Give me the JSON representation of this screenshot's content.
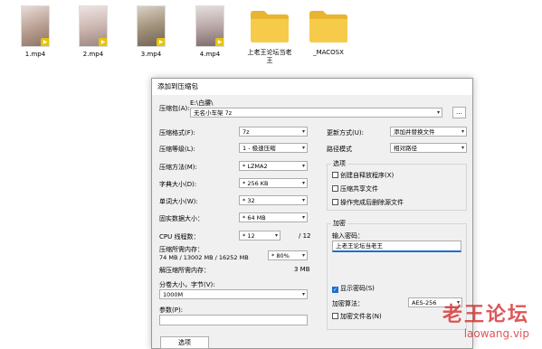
{
  "files": [
    {
      "name": "1.mp4",
      "type": "video",
      "thumb": "#c9b3a8"
    },
    {
      "name": "2.mp4",
      "type": "video",
      "thumb": "#d8c7c2"
    },
    {
      "name": "3.mp4",
      "type": "video",
      "thumb": "#a99a86"
    },
    {
      "name": "4.mp4",
      "type": "video",
      "thumb": "#c2b5b5"
    },
    {
      "name": "上老王论坛当老王",
      "type": "folder"
    },
    {
      "name": "_MACOSX",
      "type": "folder"
    }
  ],
  "dialog": {
    "title": "添加到压缩包",
    "archive_label": "压缩包(A):",
    "archive_path": "E:\\白腰\\",
    "archive_name": "无名小车架 7z",
    "browse_label": "...",
    "format_label": "压缩格式(F):",
    "format_value": "7z",
    "level_label": "压缩等级(L):",
    "level_value": "1 - 极速压缩",
    "method_label": "压缩方法(M):",
    "method_value": "* LZMA2",
    "dict_label": "字典大小(D):",
    "dict_value": "* 256 KB",
    "word_label": "单词大小(W):",
    "word_value": "* 32",
    "solid_label": "固实数据大小：",
    "solid_value": "* 64 MB",
    "cpu_label": "CPU 线程数：",
    "cpu_value": "* 12",
    "cpu_total": "/ 12",
    "mem_comp_label": "压缩所需内存：",
    "mem_comp_value": "74 MB / 13002 MB / 16252 MB",
    "mem_percent": "* 80%",
    "mem_decomp_label": "解压缩所需内存：",
    "mem_decomp_value": "3 MB",
    "split_label": "分卷大小，字节(V):",
    "split_value": "1000M",
    "params_label": "参数(P):",
    "params_value": "",
    "ok_label": "选项",
    "update_label": "更新方式(U):",
    "update_value": "添加并替换文件",
    "pathmode_label": "路径模式",
    "pathmode_value": "相对路径",
    "options_title": "选项",
    "opt_sfx": "创建自释放程序(X)",
    "opt_shared": "压缩共享文件",
    "opt_delete": "操作完成后删除源文件",
    "encrypt_title": "加密",
    "password_label": "输入密码：",
    "password_value": "上老王论坛当老王",
    "show_password": "显示密码(S)",
    "enc_method_label": "加密算法：",
    "enc_method_value": "AES-256",
    "encrypt_names": "加密文件名(N)"
  },
  "watermark": {
    "line1": "老王论坛",
    "line2": "laowang.vip"
  },
  "colors": {
    "folder": "#f5c542",
    "accent": "#1e6fd0",
    "watermark": "#d42020"
  }
}
